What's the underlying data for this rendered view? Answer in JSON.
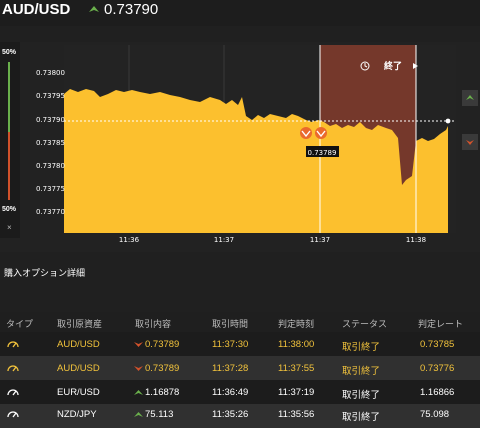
{
  "header": {
    "pair": "AUD/USD",
    "price": "0.73790",
    "trend": "up"
  },
  "chart": {
    "pct_top": "50%",
    "pct_bottom": "50%",
    "close_mark": "×",
    "end_label": "終了",
    "end_icon": "clock-icon",
    "price_tag": "0.73789",
    "y_ticks": [
      "0.73800",
      "0.73795",
      "0.73790",
      "0.73785",
      "0.73780",
      "0.73775",
      "0.73770"
    ],
    "x_ticks": [
      "11:36",
      "11:37",
      "11:37",
      "11:38"
    ]
  },
  "details": {
    "title": "購入オプション詳細"
  },
  "table": {
    "headers": [
      "タイプ",
      "取引原資産",
      "取引内容",
      "取引時間",
      "判定時刻",
      "ステータス",
      "判定レート"
    ],
    "rows": [
      {
        "asset": "AUD/USD",
        "direction": "down",
        "entry": "0.73789",
        "time": "11:37:30",
        "judge_time": "11:38:00",
        "status": "取引終了",
        "rate": "0.73785"
      },
      {
        "asset": "AUD/USD",
        "direction": "down",
        "entry": "0.73789",
        "time": "11:37:28",
        "judge_time": "11:37:55",
        "status": "取引終了",
        "rate": "0.73776"
      },
      {
        "asset": "EUR/USD",
        "direction": "up",
        "entry": "1.16878",
        "time": "11:36:49",
        "judge_time": "11:37:19",
        "status": "取引終了",
        "rate": "1.16866"
      },
      {
        "asset": "NZD/JPY",
        "direction": "up",
        "entry": "75.113",
        "time": "11:35:26",
        "judge_time": "11:35:56",
        "status": "取引終了",
        "rate": "75.098"
      }
    ]
  },
  "colors": {
    "area": "#fcc02e",
    "green": "#6ab04c",
    "red": "#d2522b",
    "end_band": "#7a3a2c"
  }
}
